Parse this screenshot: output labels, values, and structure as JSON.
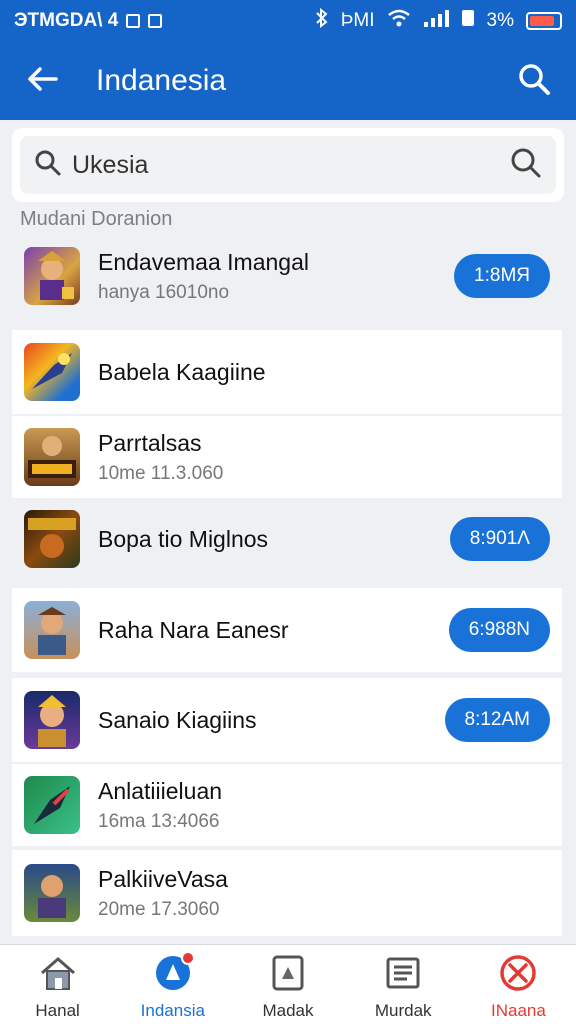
{
  "status_bar": {
    "carrier": "ЭТМGDA\\ 4",
    "signal_text": "ÞMI",
    "battery": "3%"
  },
  "app_bar": {
    "title": "Indanesia",
    "back_icon": "arrow-left-icon",
    "search_icon": "search-icon"
  },
  "search": {
    "value": "Ukesia"
  },
  "section_label": "Mudani Doranion",
  "apps": [
    {
      "name": "Endavemaa Imangal",
      "sub": "hanya 16010no",
      "action": "1:8MЯ"
    },
    {
      "name": "Babela Kaagiine",
      "sub": "",
      "action": ""
    },
    {
      "name": "Parrtalsas",
      "sub": "10me 11.3.060",
      "action": ""
    },
    {
      "name": "Bopa tio Miglnos",
      "sub": "",
      "action": "8:901Λ"
    },
    {
      "name": "Raha Nara Eanesr",
      "sub": "",
      "action": "6:988N"
    },
    {
      "name": "Sanaio Kiagiins",
      "sub": "",
      "action": "8:12AM"
    },
    {
      "name": "Anlatiiieluan",
      "sub": "16ma 13:4066",
      "action": ""
    },
    {
      "name": "PalkiiveVasa",
      "sub": "20me 17.3060",
      "action": ""
    }
  ],
  "bottom_nav": [
    {
      "label": "Hanal",
      "icon": "home-icon"
    },
    {
      "label": "Indansia",
      "icon": "notification-icon"
    },
    {
      "label": "Madak",
      "icon": "tablet-icon"
    },
    {
      "label": "Murdak",
      "icon": "list-icon"
    },
    {
      "label": "INaana",
      "icon": "close-circle-icon"
    }
  ],
  "colors": {
    "primary": "#1565c8",
    "accent": "#1972d8",
    "danger": "#e53935"
  }
}
